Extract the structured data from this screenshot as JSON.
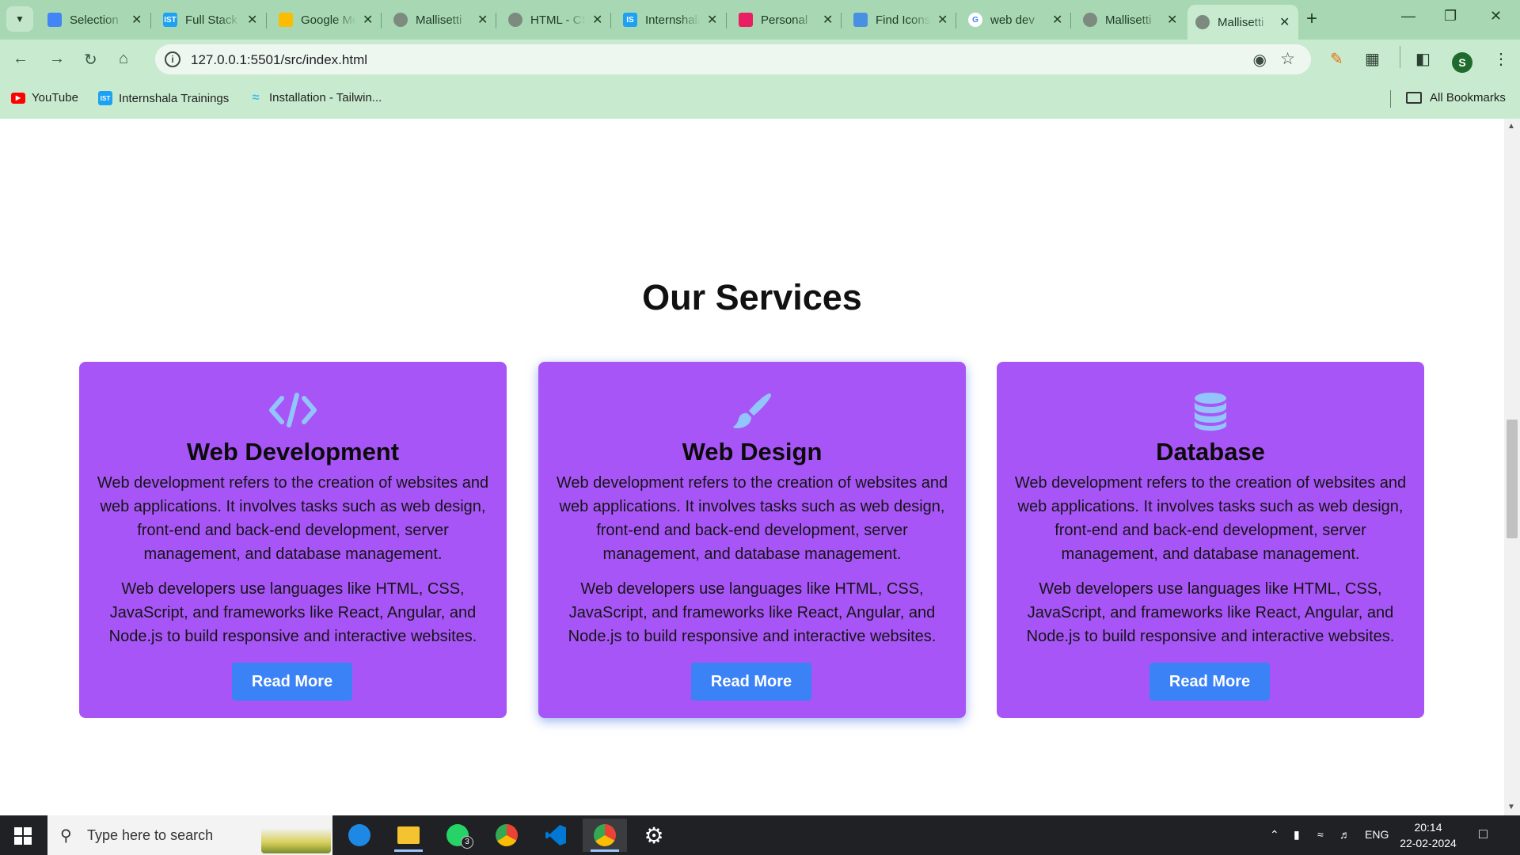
{
  "browser": {
    "tabs": [
      {
        "title": "Selection",
        "color": "#4285f4",
        "icon_name": "figma-like-icon"
      },
      {
        "title": "Full Stack",
        "color": "#1da1f2",
        "icon_name": "internshala-icon"
      },
      {
        "title": "Google Meet",
        "color": "#fbbc04",
        "icon_name": "google-meet-icon"
      },
      {
        "title": "Mallisetti",
        "color": "#5f6368",
        "icon_name": "globe-icon"
      },
      {
        "title": "HTML - CSS",
        "color": "#5f6368",
        "icon_name": "globe-icon"
      },
      {
        "title": "Internshala",
        "color": "#1da1f2",
        "icon_name": "internshala-icon"
      },
      {
        "title": "Personal",
        "color": "#e91e63",
        "icon_name": "figma-icon"
      },
      {
        "title": "Find Icons",
        "color": "#4a90e2",
        "icon_name": "flag-icon"
      },
      {
        "title": "web dev",
        "color": "#4285f4",
        "icon_name": "google-icon"
      },
      {
        "title": "Mallisetti",
        "color": "#5f6368",
        "icon_name": "globe-icon"
      },
      {
        "title": "Mallisetti",
        "color": "#5f6368",
        "icon_name": "globe-icon"
      }
    ],
    "url": "127.0.0.1:5501/src/index.html",
    "profile_initial": "S",
    "bookmarks": [
      {
        "label": "YouTube",
        "color": "#ff0000",
        "icon_name": "youtube-icon"
      },
      {
        "label": "Internshala Trainings",
        "color": "#1da1f2",
        "icon_name": "internshala-icon"
      },
      {
        "label": "Installation - Tailwin...",
        "color": "#38bdf8",
        "icon_name": "tailwind-icon"
      }
    ],
    "all_bookmarks": "All Bookmarks"
  },
  "page": {
    "section_title": "Our Services",
    "cards": [
      {
        "icon_name": "code-icon",
        "title": "Web Development",
        "paragraph1": "Web development refers to the creation of websites and web applications. It involves tasks such as web design, front-end and back-end development, server management, and database management.",
        "paragraph2": "Web developers use languages like HTML, CSS, JavaScript, and frameworks like React, Angular, and Node.js to build responsive and interactive websites.",
        "button": "Read More"
      },
      {
        "icon_name": "paintbrush-icon",
        "title": "Web Design",
        "paragraph1": "Web development refers to the creation of websites and web applications. It involves tasks such as web design, front-end and back-end development, server management, and database management.",
        "paragraph2": "Web developers use languages like HTML, CSS, JavaScript, and frameworks like React, Angular, and Node.js to build responsive and interactive websites.",
        "button": "Read More"
      },
      {
        "icon_name": "database-icon",
        "title": "Database",
        "paragraph1": "Web development refers to the creation of websites and web applications. It involves tasks such as web design, front-end and back-end development, server management, and database management.",
        "paragraph2": "Web developers use languages like HTML, CSS, JavaScript, and frameworks like React, Angular, and Node.js to build responsive and interactive websites.",
        "button": "Read More"
      }
    ],
    "card_color": "#a855f7",
    "button_color": "#3b82f6"
  },
  "taskbar": {
    "search_placeholder": "Type here to search",
    "whatsapp_badge": "3",
    "language": "ENG",
    "time": "20:14",
    "date": "22-02-2024"
  }
}
